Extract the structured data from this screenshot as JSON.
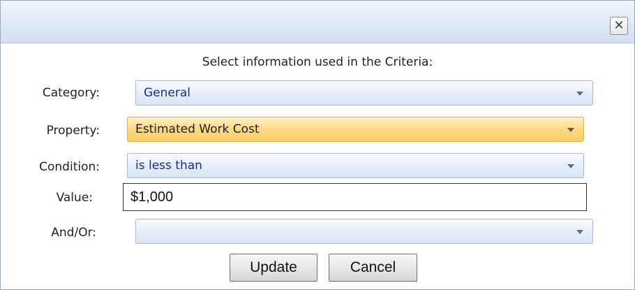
{
  "dialog": {
    "close_glyph": "✕",
    "heading": "Select information used in the Criteria:"
  },
  "fields": {
    "category": {
      "label": "Category:",
      "value": "General"
    },
    "property": {
      "label": "Property:",
      "value": "Estimated Work Cost"
    },
    "condition": {
      "label": "Condition:",
      "value": "is less than"
    },
    "value": {
      "label": "Value:",
      "value": "$1,000"
    },
    "and_or": {
      "label": "And/Or:",
      "value": ""
    }
  },
  "buttons": {
    "update": "Update",
    "cancel": "Cancel"
  },
  "colors": {
    "accent_active_combo": "#fcd06a",
    "combo_text": "#1c2f86",
    "titlebar": "#dfe8f5"
  }
}
